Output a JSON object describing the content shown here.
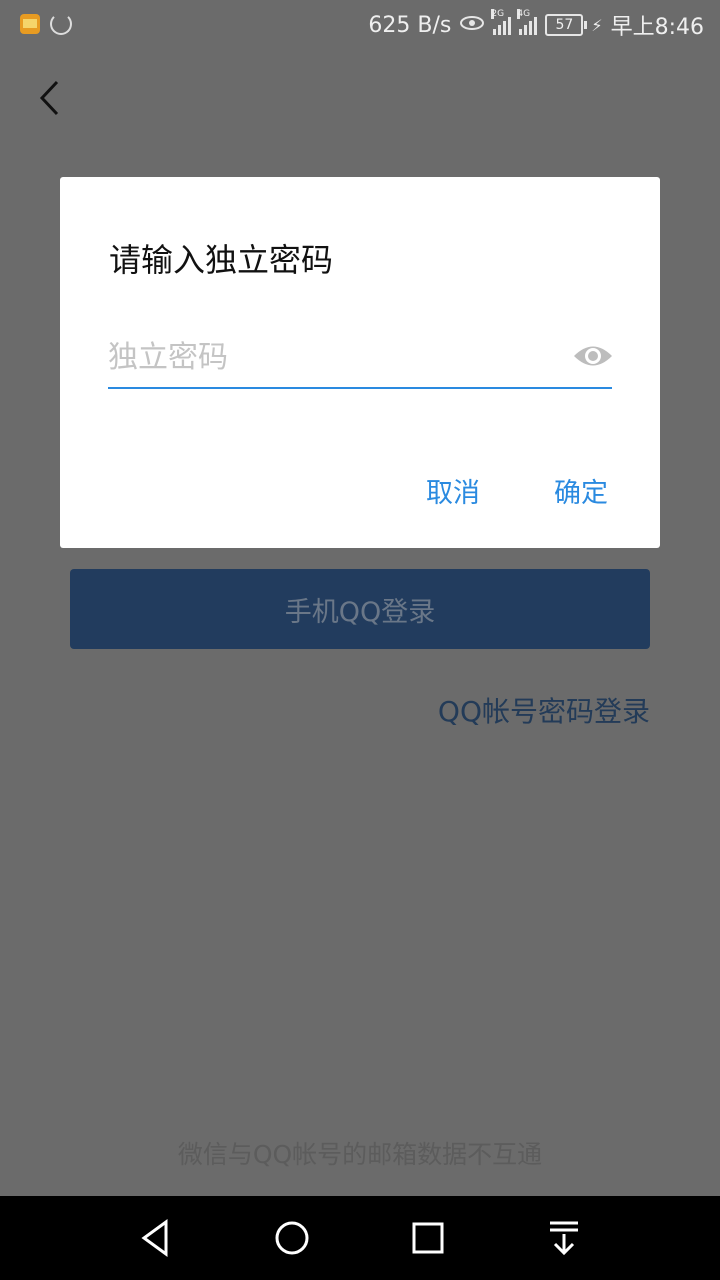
{
  "status_bar": {
    "net_speed": "625 B/s",
    "sim1": "2G",
    "sim2": "4G",
    "battery": "57",
    "time": "早上8:46"
  },
  "dialog": {
    "title": "请输入独立密码",
    "password_placeholder": "独立密码",
    "password_value": "",
    "cancel_label": "取消",
    "confirm_label": "确定"
  },
  "page": {
    "phone_login_label": "手机QQ登录",
    "qq_password_login_label": "QQ帐号密码登录",
    "footer_note": "微信与QQ帐号的邮箱数据不互通"
  },
  "colors": {
    "accent": "#2a8ae0",
    "overlay_bg": "#6b6b6b",
    "dim_button": "#223c5e"
  }
}
